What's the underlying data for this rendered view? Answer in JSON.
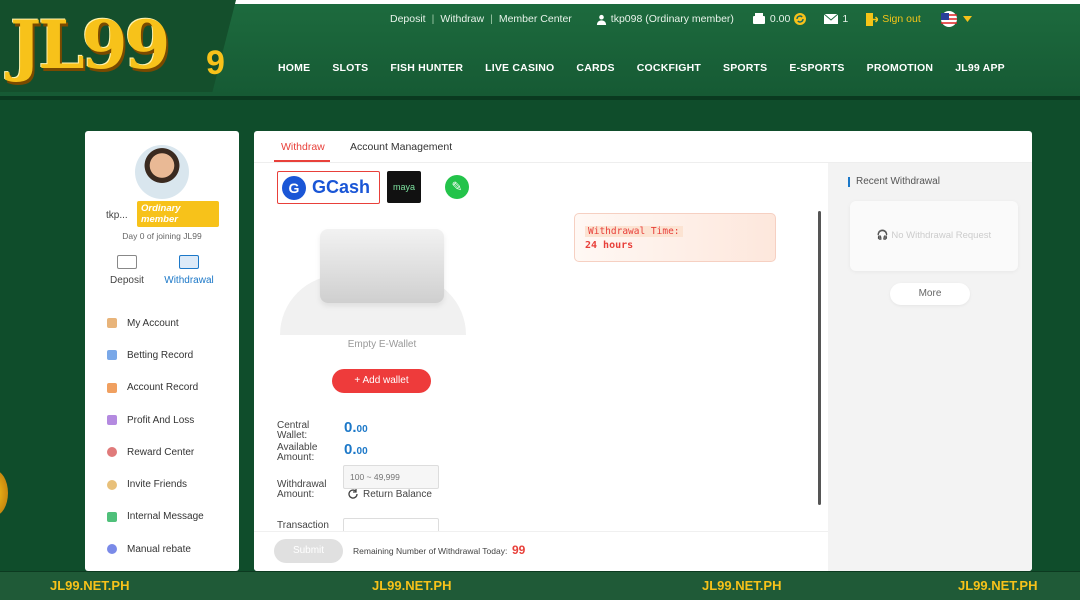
{
  "header": {
    "logo": "JL99",
    "logo_suffix": "9",
    "util_links": [
      "Deposit",
      "Withdraw",
      "Member Center"
    ],
    "user": "tkp098 (Ordinary member)",
    "balance": "0.00",
    "messages": "1",
    "signout": "Sign out",
    "nav": [
      "HOME",
      "SLOTS",
      "FISH HUNTER",
      "LIVE CASINO",
      "CARDS",
      "COCKFIGHT",
      "SPORTS",
      "E-SPORTS",
      "PROMOTION",
      "JL99 APP"
    ]
  },
  "sidebar": {
    "username": "tkp...",
    "badge": "Ordinary member",
    "joined": "Day 0 of joining JL99",
    "quick_actions": [
      "Deposit",
      "Withdrawal"
    ],
    "menu": [
      "My Account",
      "Betting Record",
      "Account Record",
      "Profit And Loss",
      "Reward Center",
      "Invite Friends",
      "Internal Message",
      "Manual rebate"
    ]
  },
  "main": {
    "tabs": [
      "Withdraw",
      "Account Management"
    ],
    "gcash": "GCash",
    "maya": "maya",
    "empty_wallet": "Empty E-Wallet",
    "add_wallet": "+ Add wallet",
    "withdrawal_time_label": "Withdrawal Time:",
    "withdrawal_time_value": "24 hours",
    "central_wallet_label": "Central Wallet:",
    "central_wallet_value": "0.",
    "central_wallet_decimal": "00",
    "available_label": "Available Amount:",
    "available_value": "0.",
    "available_decimal": "00",
    "withdrawal_amount_label": "Withdrawal Amount:",
    "amount_placeholder": "100 ~ 49,999",
    "return_balance": "Return Balance",
    "transaction_label": "Transaction",
    "submit": "Submit",
    "remaining_label": "Remaining Number of Withdrawal Today:",
    "remaining_count": "99"
  },
  "right_panel": {
    "title": "Recent Withdrawal",
    "empty": "No Withdrawal Request",
    "more": "More"
  },
  "footer": [
    "JL99.NET.PH",
    "JL99.NET.PH",
    "JL99.NET.PH",
    "JL99.NET.PH"
  ],
  "colors": {
    "brand_green": "#1d6b3e",
    "accent_red": "#e8403a",
    "gold": "#f7c21a",
    "blue": "#1c78c8"
  }
}
